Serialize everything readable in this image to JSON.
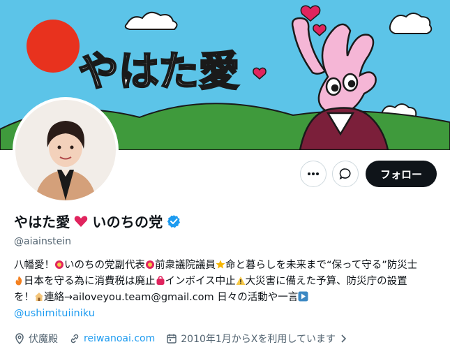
{
  "banner": {
    "title_text": "やはた愛",
    "sky_color": "#5cc4e8",
    "sun_color": "#e8321e",
    "hill_color": "#3f9a3c"
  },
  "profile": {
    "display_name": "やはた愛",
    "name_suffix": "いのちの党",
    "verified": true,
    "handle": "@aiainstein"
  },
  "actions": {
    "more_icon": "more-icon",
    "message_icon": "message-icon",
    "follow_label": "フォロー"
  },
  "bio": {
    "text1": "八幡愛！",
    "text2": "いのちの党副代表",
    "text3": "前衆議院議員",
    "text4": "命と暮らしを未来まで“保って守る”防災士",
    "text5": "日本を守る為に消費税は廃止",
    "text6": "インボイス中止",
    "text7": "大災害に備えた予算、防災庁の設置を！",
    "text8": "連絡→ailoveyou.team@gmail.com 日々の活動や一言",
    "mention": "@ushimituiiniku"
  },
  "meta": {
    "location": "伏魔殿",
    "website": "reiwanoai.com",
    "joined": "2010年1月からXを利用しています"
  },
  "colors": {
    "accent": "#1d9bf0",
    "secondary_text": "#536471",
    "heart": "#e0245e"
  }
}
